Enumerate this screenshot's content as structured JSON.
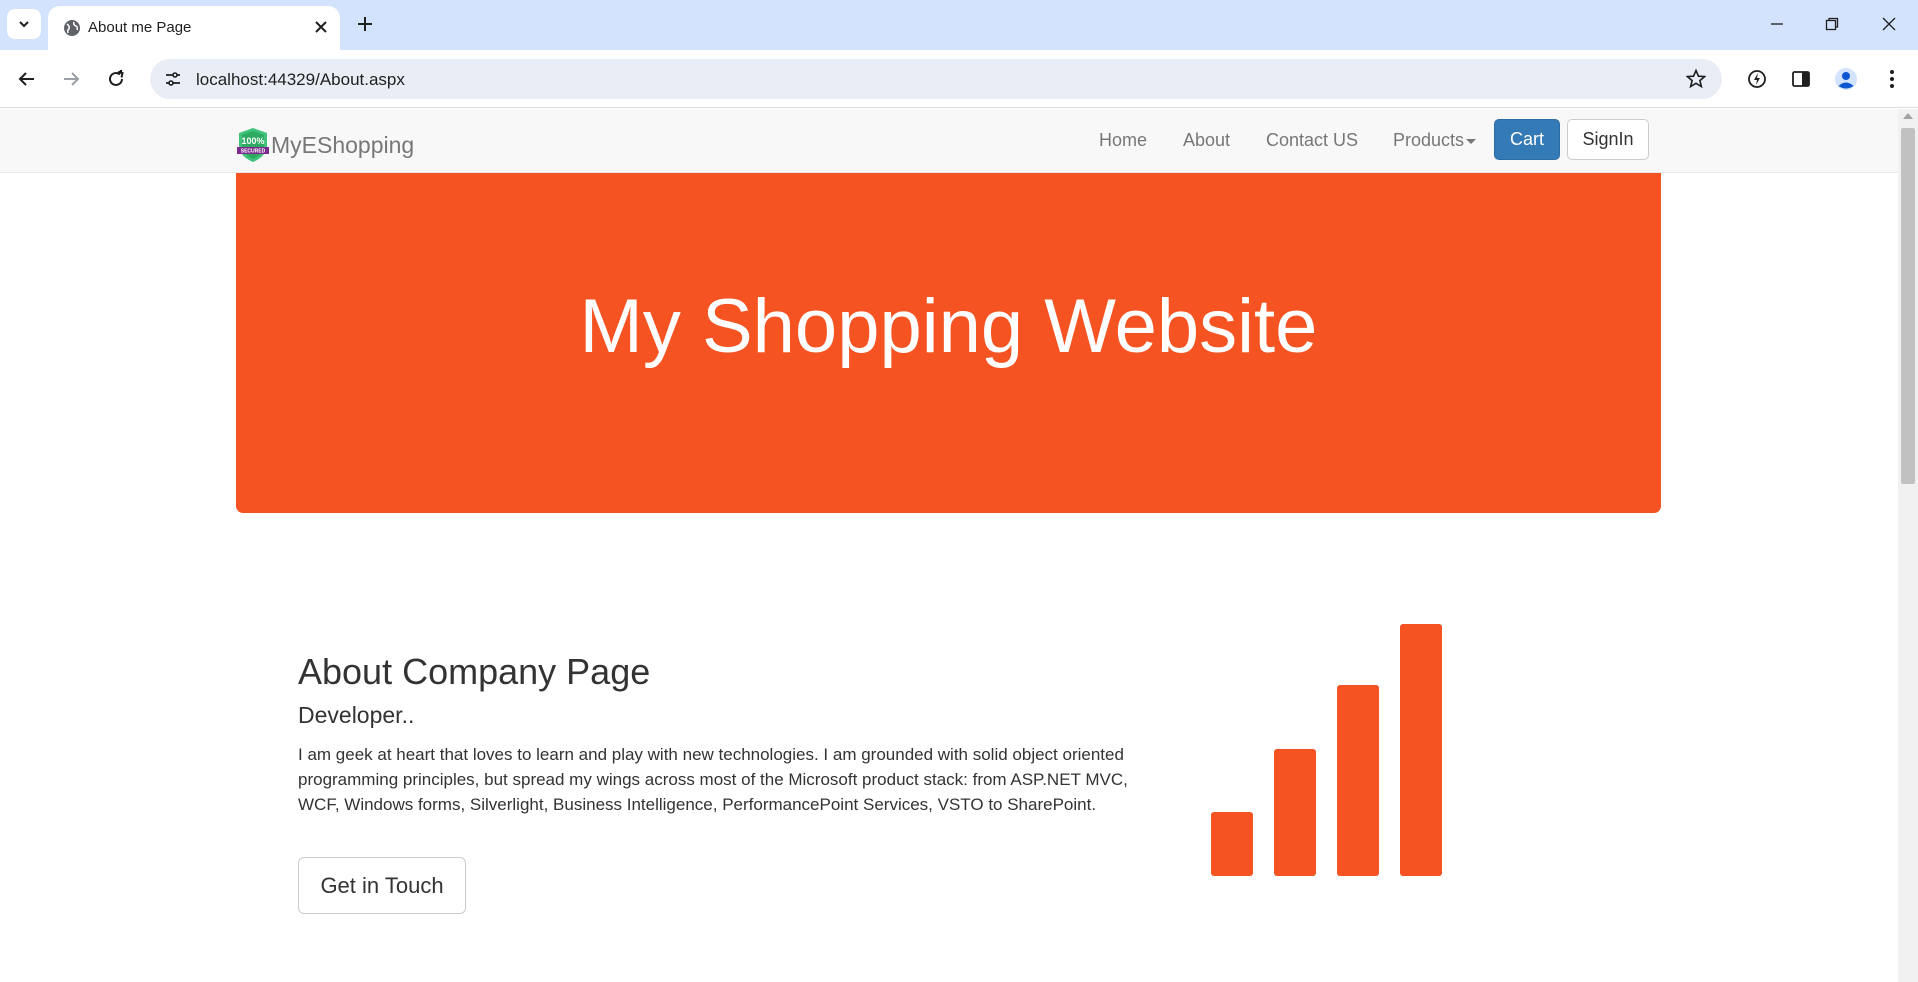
{
  "browser": {
    "tab_title": "About me Page",
    "url": "localhost:44329/About.aspx"
  },
  "site": {
    "brand": "MyEShopping",
    "logo_text_top": "100%",
    "logo_text_bottom": "SECURED",
    "nav": {
      "home": "Home",
      "about": "About",
      "contact": "Contact US",
      "products": "Products",
      "cart": "Cart",
      "signin": "SignIn"
    }
  },
  "hero": {
    "title": "My Shopping Website"
  },
  "about": {
    "title": "About Company Page",
    "subtitle": "Developer..",
    "paragraph": "I am geek at heart that loves to learn and play with new technologies. I am grounded with solid object oriented programming principles, but spread my wings across most of the Microsoft product stack: from ASP.NET MVC, WCF, Windows forms, Silverlight, Business Intelligence, PerformancePoint Services, VSTO to SharePoint.",
    "cta": "Get in Touch"
  },
  "colors": {
    "accent": "#f55321",
    "primary_button": "#337ab7",
    "navbar_bg": "#f8f8f8",
    "tabstrip_bg": "#d3e3fd"
  },
  "icons": {
    "decorative_graphic": "signal-bars-icon"
  }
}
